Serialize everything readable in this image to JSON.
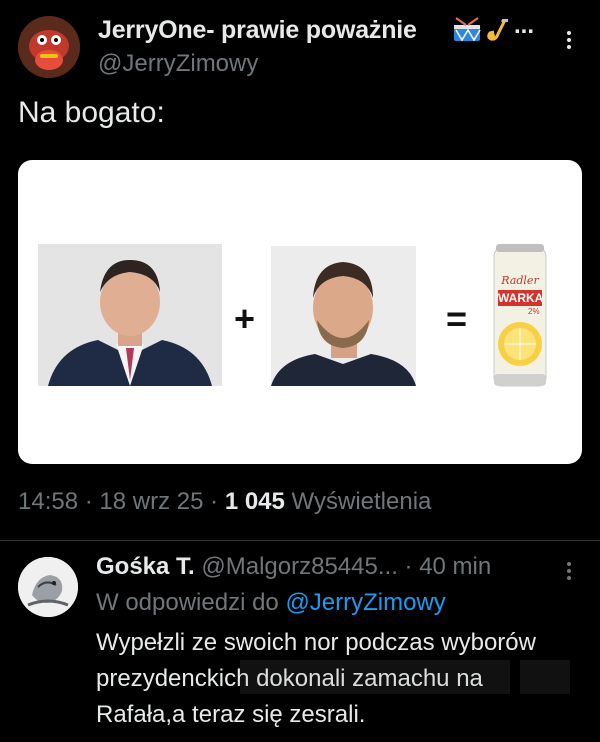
{
  "post": {
    "display_name": "JerryOne- prawie poważnie",
    "name_truncation": "...",
    "handle": "@JerryZimowy",
    "text": "Na bogato:",
    "media": {
      "plus_sign": "+",
      "equals_sign": "=",
      "can_brand": "Radler",
      "can_name": "WARKA",
      "can_abv": "2%"
    },
    "time": "14:58",
    "date": "18 wrz 25",
    "separator": "·",
    "views_count": "1 045",
    "views_label": "Wyświetlenia"
  },
  "reply": {
    "display_name": "Gośka T.",
    "handle": "@Malgorz85445...",
    "time": "· 40 min",
    "in_reply_prefix": "W odpowiedzi do",
    "in_reply_handle": "@JerryZimowy",
    "text": "Wypełzli ze swoich nor podczas wyborów prezydenckich dokonali zamachu na Rafała,a teraz się zesrali."
  },
  "colors": {
    "background": "#000000",
    "text_primary": "#e7e9ea",
    "text_secondary": "#71767b",
    "link": "#1d9bf0",
    "divider": "#2f3336"
  }
}
